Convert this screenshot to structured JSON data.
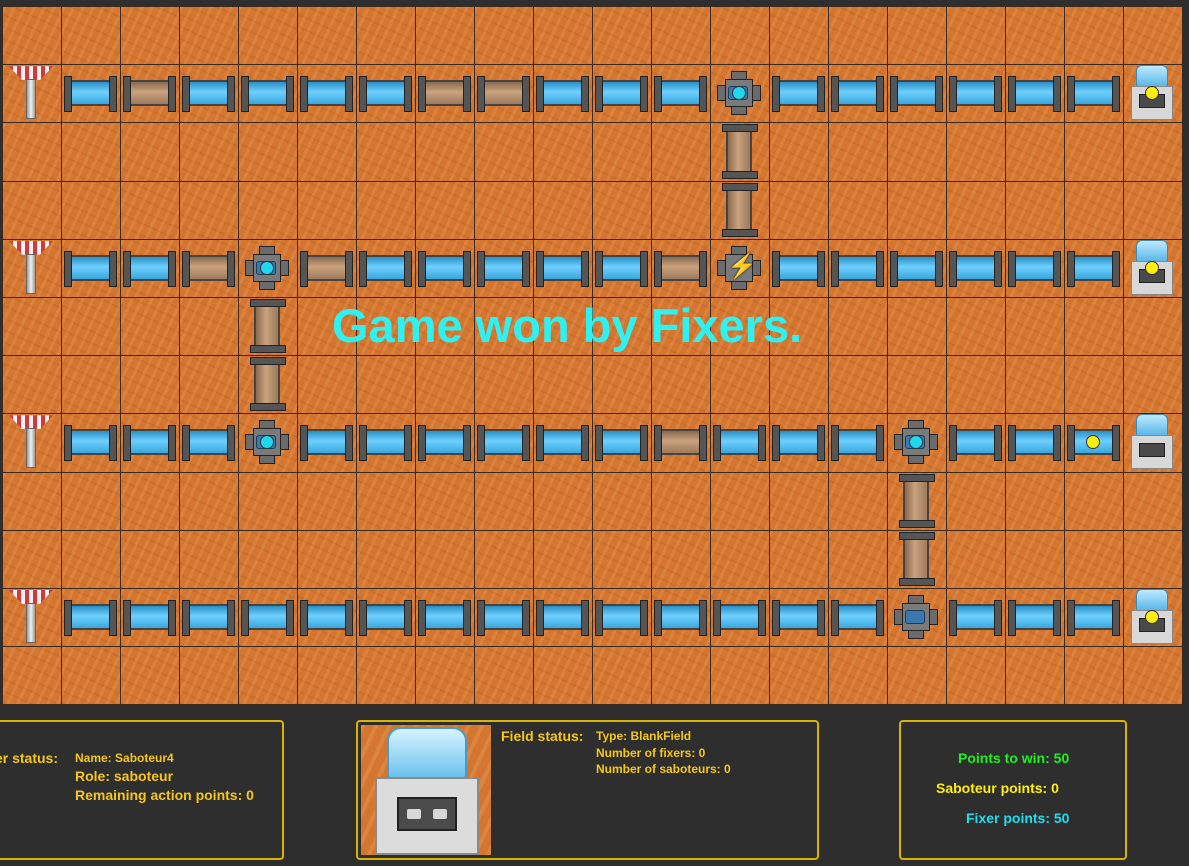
{
  "board": {
    "rows": 12,
    "cols": 20,
    "tile_colors": {
      "sand": "#d4762f",
      "water": "#5bc3f5",
      "empty_pipe": "#b8926c"
    },
    "sources_rows": [
      1,
      4,
      7,
      10
    ],
    "cisterns_rows": [
      1,
      4,
      7,
      10
    ],
    "horizontal_pipes": [
      {
        "row": 1,
        "cells": [
          "w",
          "e",
          "w",
          "w",
          "w",
          "w",
          "e",
          "e",
          "w",
          "w",
          "w",
          "P",
          "w",
          "w",
          "w",
          "w",
          "w",
          "w"
        ]
      },
      {
        "row": 4,
        "cells": [
          "w",
          "w",
          "e",
          "P",
          "e",
          "w",
          "w",
          "w",
          "w",
          "w",
          "e",
          "B",
          "w",
          "w",
          "w",
          "w",
          "w",
          "w"
        ]
      },
      {
        "row": 7,
        "cells": [
          "w",
          "w",
          "w",
          "P",
          "w",
          "w",
          "w",
          "w",
          "w",
          "w",
          "e",
          "w",
          "w",
          "w",
          "P",
          "w",
          "w",
          "w"
        ]
      },
      {
        "row": 10,
        "cells": [
          "w",
          "w",
          "w",
          "w",
          "w",
          "w",
          "w",
          "w",
          "w",
          "w",
          "w",
          "w",
          "w",
          "w",
          "P",
          "w",
          "w",
          "w"
        ]
      }
    ],
    "vertical_pipes": [
      {
        "col": 12,
        "rows": [
          2,
          3
        ],
        "state": "empty"
      },
      {
        "col": 4,
        "rows": [
          5,
          6
        ],
        "state": "empty"
      },
      {
        "col": 15,
        "rows": [
          8,
          9
        ],
        "state": "empty"
      }
    ],
    "players": [
      {
        "row": 1,
        "col": 12,
        "role": "fixer"
      },
      {
        "row": 4,
        "col": 4,
        "role": "fixer"
      },
      {
        "row": 7,
        "col": 4,
        "role": "fixer"
      },
      {
        "row": 7,
        "col": 15,
        "role": "fixer"
      },
      {
        "row": 1,
        "col": 19,
        "role": "saboteur"
      },
      {
        "row": 4,
        "col": 19,
        "role": "saboteur"
      },
      {
        "row": 7,
        "col": 18,
        "role": "saboteur"
      },
      {
        "row": 10,
        "col": 19,
        "role": "saboteur"
      }
    ]
  },
  "banner": "Game won by Fixers.",
  "player_status": {
    "label": "Player status:",
    "name": "Name: Saboteur4",
    "role": "Role: saboteur",
    "action_points": "Remaining action points: 0"
  },
  "field_status": {
    "label": "Field status:",
    "type": "Type: BlankField",
    "fixers": "Number of fixers: 0",
    "saboteurs": "Number of saboteurs: 0"
  },
  "score": {
    "points_to_win": "Points to win: 50",
    "saboteur_points": "Saboteur points: 0",
    "fixer_points": "Fixer points: 50",
    "colors": {
      "win": "#22ee22",
      "saboteur": "#ffee11",
      "fixer": "#22ddee"
    }
  }
}
